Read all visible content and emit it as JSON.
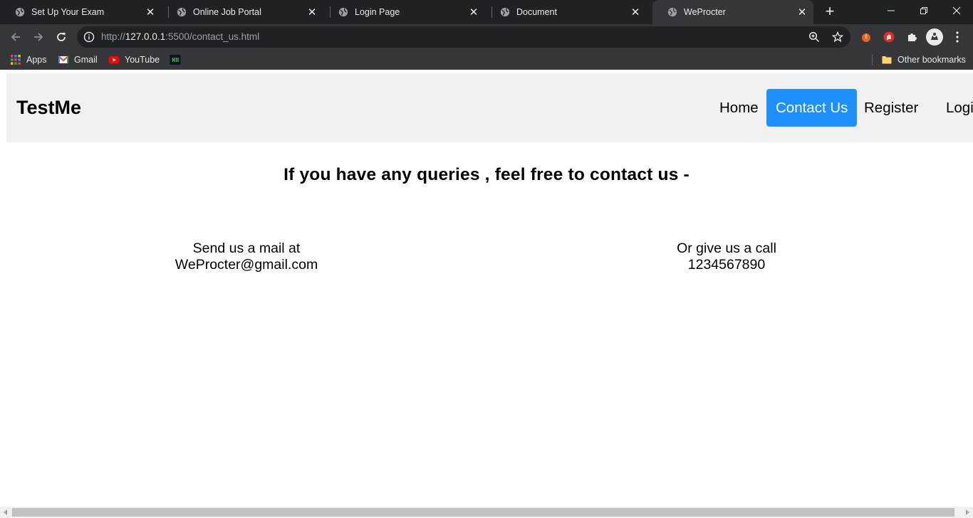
{
  "tabs": [
    {
      "title": "Set Up Your Exam",
      "active": false
    },
    {
      "title": "Online Job Portal",
      "active": false
    },
    {
      "title": "Login Page",
      "active": false
    },
    {
      "title": "Document",
      "active": false
    },
    {
      "title": "WeProcter",
      "active": true
    }
  ],
  "address_bar": {
    "scheme": "http://",
    "host": "127.0.0.1",
    "rest": ":5500/contact_us.html"
  },
  "bookmarks": {
    "items": [
      {
        "label": "Apps",
        "icon": "apps-grid-icon"
      },
      {
        "label": "Gmail",
        "icon": "gmail-icon"
      },
      {
        "label": "YouTube",
        "icon": "youtube-icon"
      }
    ],
    "other": "Other bookmarks"
  },
  "site": {
    "brand": "TestMe",
    "nav": [
      {
        "label": "Home",
        "active": false
      },
      {
        "label": "Contact Us",
        "active": true
      },
      {
        "label": "Register",
        "active": false
      },
      {
        "label": "Login",
        "active": false
      }
    ],
    "accent_color": "#1e90ff",
    "heading": "If you have any queries , feel free to contact us -",
    "mail": {
      "line1": "Send us a mail at",
      "line2": "WeProcter@gmail.com"
    },
    "call": {
      "line1": "Or give us a call",
      "line2": "1234567890"
    }
  }
}
